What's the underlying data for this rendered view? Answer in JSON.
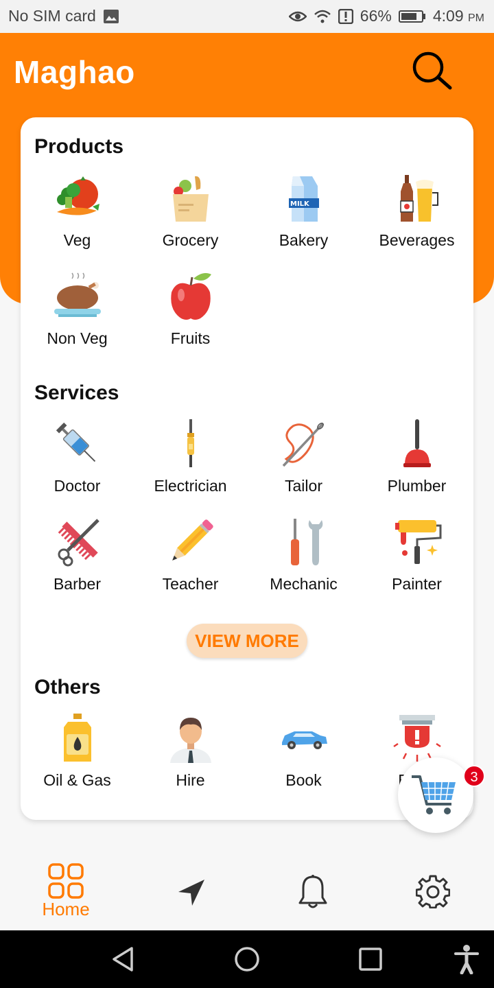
{
  "status_bar": {
    "carrier": "No SIM card",
    "battery": "66%",
    "time": "4:09",
    "ampm": "PM",
    "icons": [
      "image-icon",
      "eye-icon",
      "wifi-icon",
      "alert-icon",
      "battery-icon"
    ]
  },
  "header": {
    "brand": "Maghao",
    "accent_color": "#ff8005"
  },
  "sections": {
    "products": {
      "title": "Products",
      "items": [
        {
          "label": "Veg",
          "icon": "veg-icon"
        },
        {
          "label": "Grocery",
          "icon": "grocery-bag-icon"
        },
        {
          "label": "Bakery",
          "icon": "milk-carton-icon"
        },
        {
          "label": "Beverages",
          "icon": "beverages-icon"
        },
        {
          "label": "Non Veg",
          "icon": "roast-chicken-icon"
        },
        {
          "label": "Fruits",
          "icon": "apple-icon"
        }
      ]
    },
    "services": {
      "title": "Services",
      "items": [
        {
          "label": "Doctor",
          "icon": "syringe-icon"
        },
        {
          "label": "Electrician",
          "icon": "soldering-iron-icon"
        },
        {
          "label": "Tailor",
          "icon": "needle-thread-icon"
        },
        {
          "label": "Plumber",
          "icon": "plunger-icon"
        },
        {
          "label": "Barber",
          "icon": "comb-scissors-icon"
        },
        {
          "label": "Teacher",
          "icon": "pencil-icon"
        },
        {
          "label": "Mechanic",
          "icon": "wrench-screwdriver-icon"
        },
        {
          "label": "Painter",
          "icon": "paint-roller-icon"
        }
      ],
      "view_more": "VIEW MORE"
    },
    "others": {
      "title": "Others",
      "items": [
        {
          "label": "Oil & Gas",
          "icon": "oil-can-icon"
        },
        {
          "label": "Hire",
          "icon": "person-icon"
        },
        {
          "label": "Book",
          "icon": "car-icon"
        },
        {
          "label": "Em",
          "icon": "emergency-alarm-icon"
        }
      ]
    }
  },
  "cart": {
    "badge_count": "3",
    "icon": "shopping-cart-icon"
  },
  "bottom_nav": {
    "items": [
      {
        "label": "Home",
        "icon": "home-grid-icon",
        "active": true
      },
      {
        "label": "",
        "icon": "navigation-icon"
      },
      {
        "label": "",
        "icon": "bell-icon"
      },
      {
        "label": "",
        "icon": "settings-icon"
      }
    ]
  }
}
